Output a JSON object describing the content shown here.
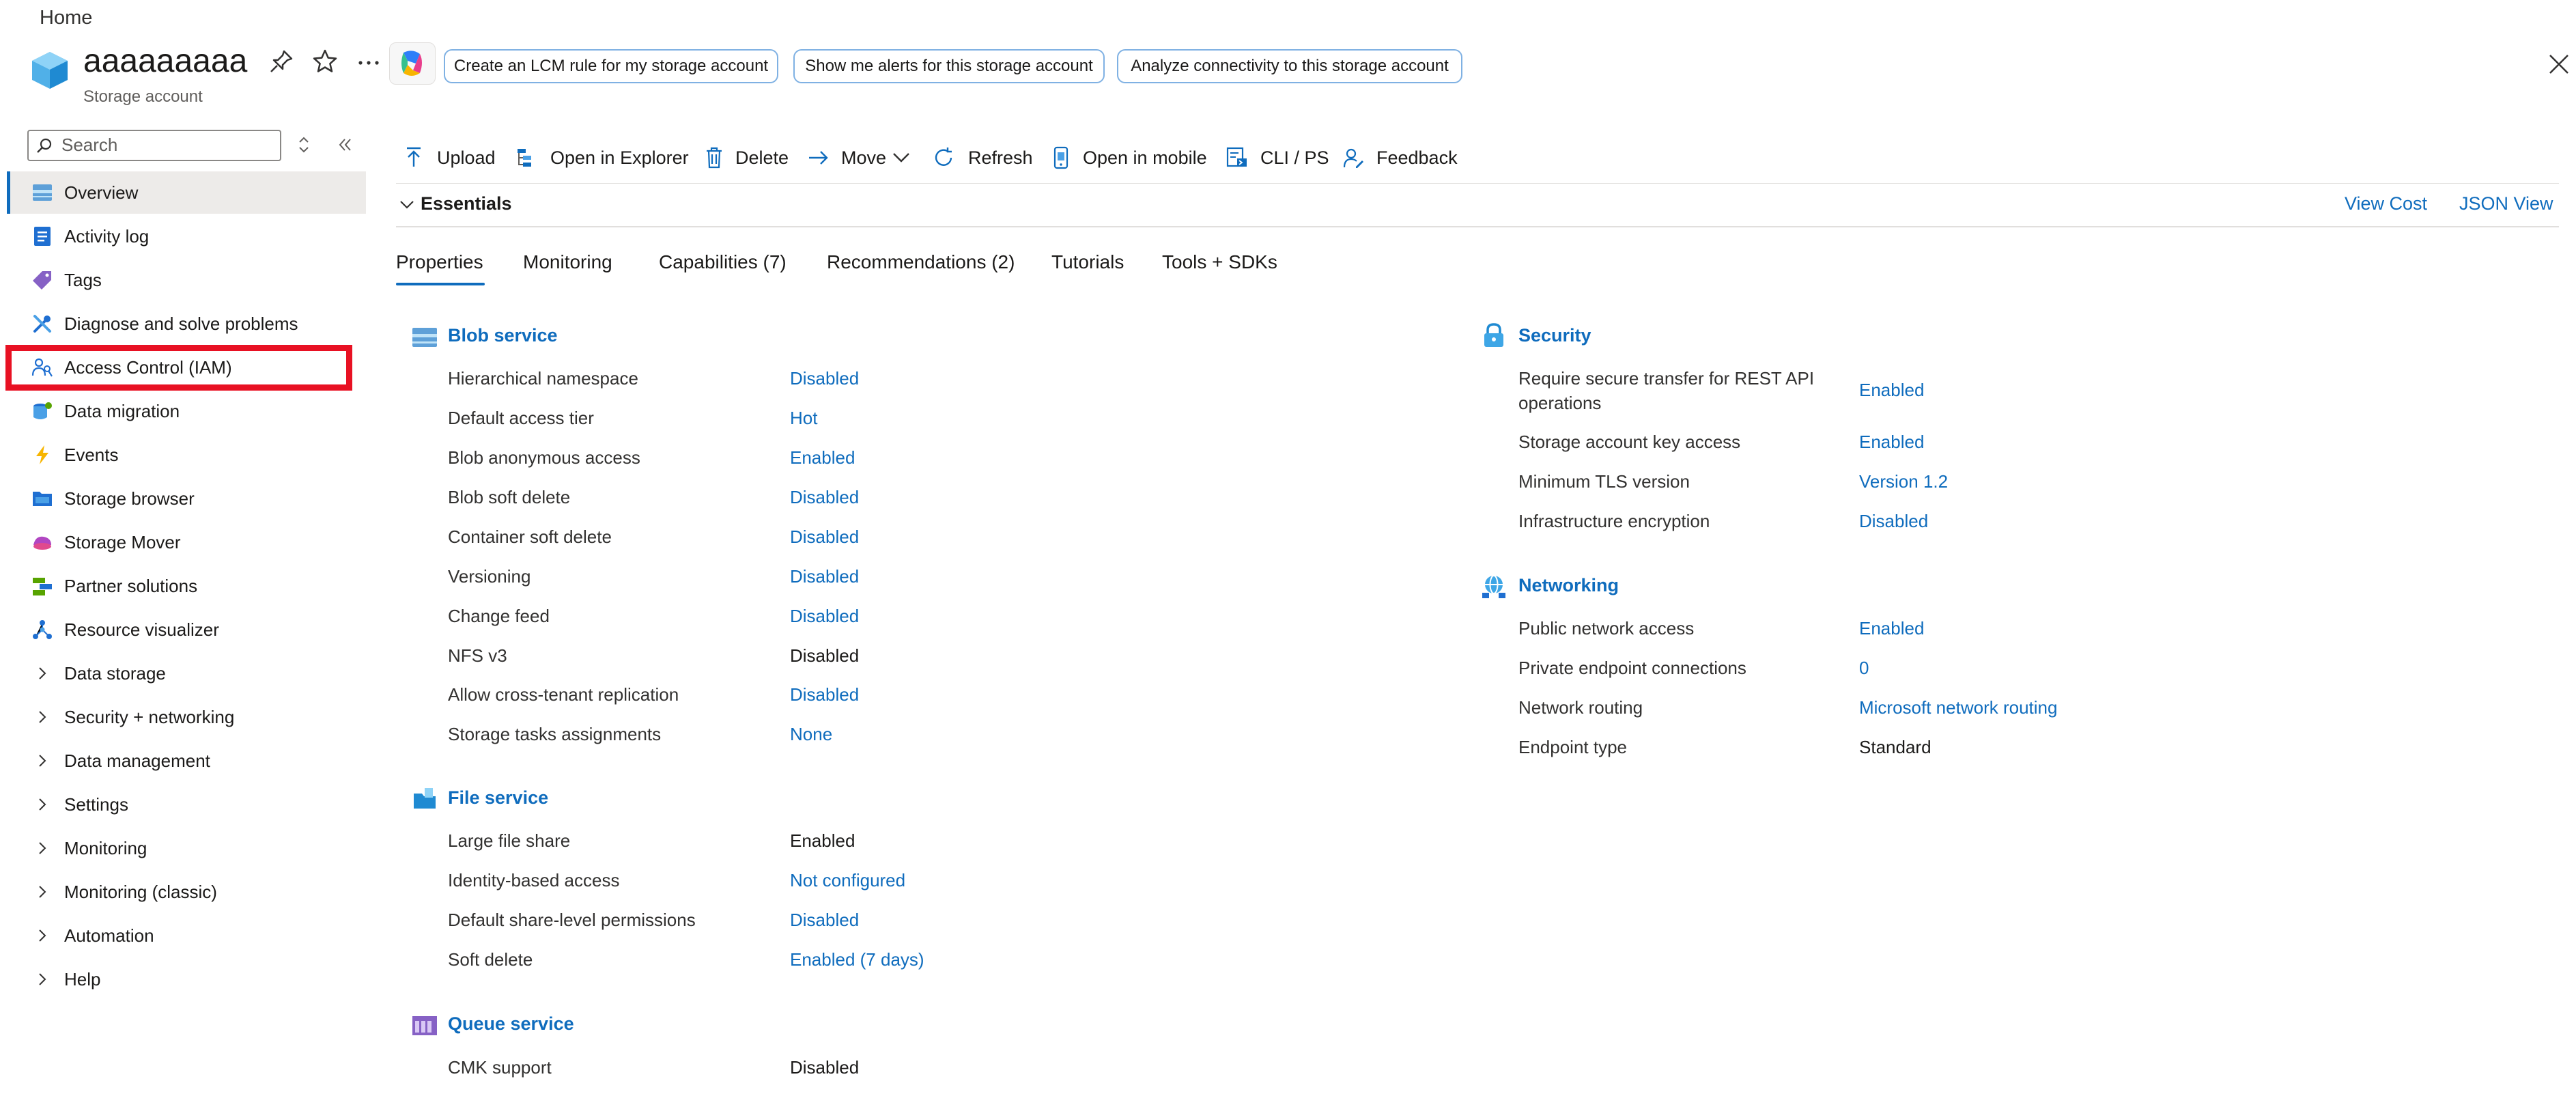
{
  "breadcrumb": "Home",
  "resource": {
    "name": "aaaaaaaaa",
    "type": "Storage account"
  },
  "suggestions": [
    "Create an LCM rule for my storage account",
    "Show me alerts for this storage account",
    "Analyze connectivity to this storage account"
  ],
  "sidebar": {
    "search_placeholder": "Search",
    "items": [
      {
        "label": "Overview",
        "icon": "storage-icon"
      },
      {
        "label": "Activity log",
        "icon": "activity-log-icon"
      },
      {
        "label": "Tags",
        "icon": "tag-icon"
      },
      {
        "label": "Diagnose and solve problems",
        "icon": "wrench-icon"
      },
      {
        "label": "Access Control (IAM)",
        "icon": "people-icon"
      },
      {
        "label": "Data migration",
        "icon": "data-migration-icon"
      },
      {
        "label": "Events",
        "icon": "lightning-icon"
      },
      {
        "label": "Storage browser",
        "icon": "folder-icon"
      },
      {
        "label": "Storage Mover",
        "icon": "storage-mover-icon"
      },
      {
        "label": "Partner solutions",
        "icon": "partner-icon"
      },
      {
        "label": "Resource visualizer",
        "icon": "visualizer-icon"
      },
      {
        "label": "Data storage",
        "icon": "chevron-right-icon"
      },
      {
        "label": "Security + networking",
        "icon": "chevron-right-icon"
      },
      {
        "label": "Data management",
        "icon": "chevron-right-icon"
      },
      {
        "label": "Settings",
        "icon": "chevron-right-icon"
      },
      {
        "label": "Monitoring",
        "icon": "chevron-right-icon"
      },
      {
        "label": "Monitoring (classic)",
        "icon": "chevron-right-icon"
      },
      {
        "label": "Automation",
        "icon": "chevron-right-icon"
      },
      {
        "label": "Help",
        "icon": "chevron-right-icon"
      }
    ]
  },
  "toolbar": {
    "upload": "Upload",
    "open_explorer": "Open in Explorer",
    "delete": "Delete",
    "move": "Move",
    "refresh": "Refresh",
    "open_mobile": "Open in mobile",
    "cli": "CLI / PS",
    "feedback": "Feedback"
  },
  "essentials": {
    "label": "Essentials",
    "view_cost": "View Cost",
    "json_view": "JSON View"
  },
  "tabs": [
    "Properties",
    "Monitoring",
    "Capabilities (7)",
    "Recommendations (2)",
    "Tutorials",
    "Tools + SDKs"
  ],
  "sections": {
    "blob": {
      "title": "Blob service",
      "rows": [
        {
          "label": "Hierarchical namespace",
          "value": "Disabled",
          "link": true
        },
        {
          "label": "Default access tier",
          "value": "Hot",
          "link": true
        },
        {
          "label": "Blob anonymous access",
          "value": "Enabled",
          "link": true
        },
        {
          "label": "Blob soft delete",
          "value": "Disabled",
          "link": true
        },
        {
          "label": "Container soft delete",
          "value": "Disabled",
          "link": true
        },
        {
          "label": "Versioning",
          "value": "Disabled",
          "link": true
        },
        {
          "label": "Change feed",
          "value": "Disabled",
          "link": true
        },
        {
          "label": "NFS v3",
          "value": "Disabled",
          "link": false
        },
        {
          "label": "Allow cross-tenant replication",
          "value": "Disabled",
          "link": true
        },
        {
          "label": "Storage tasks assignments",
          "value": "None",
          "link": true
        }
      ]
    },
    "file": {
      "title": "File service",
      "rows": [
        {
          "label": "Large file share",
          "value": "Enabled",
          "link": false
        },
        {
          "label": "Identity-based access",
          "value": "Not configured",
          "link": true
        },
        {
          "label": "Default share-level permissions",
          "value": "Disabled",
          "link": true
        },
        {
          "label": "Soft delete",
          "value": "Enabled (7 days)",
          "link": true
        }
      ]
    },
    "queue": {
      "title": "Queue service",
      "rows": [
        {
          "label": "CMK support",
          "value": "Disabled",
          "link": false
        }
      ]
    },
    "security": {
      "title": "Security",
      "rows": [
        {
          "label": "Require secure transfer for REST API",
          "label2": "operations",
          "value": "Enabled",
          "link": true
        },
        {
          "label": "Storage account key access",
          "value": "Enabled",
          "link": true
        },
        {
          "label": "Minimum TLS version",
          "value": "Version 1.2",
          "link": true
        },
        {
          "label": "Infrastructure encryption",
          "value": "Disabled",
          "link": true
        }
      ]
    },
    "networking": {
      "title": "Networking",
      "rows": [
        {
          "label": "Public network access",
          "value": "Enabled",
          "link": true
        },
        {
          "label": "Private endpoint connections",
          "value": "0",
          "link": true
        },
        {
          "label": "Network routing",
          "value": "Microsoft network routing",
          "link": true
        },
        {
          "label": "Endpoint type",
          "value": "Standard",
          "link": false
        }
      ]
    }
  },
  "colors": {
    "accent": "#0f6cbd",
    "highlight": "#e81123"
  }
}
